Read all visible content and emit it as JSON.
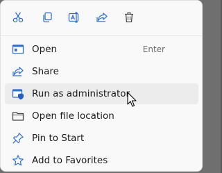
{
  "toolbar": {
    "buttons": [
      {
        "name": "cut-icon"
      },
      {
        "name": "copy-icon"
      },
      {
        "name": "rename-icon"
      },
      {
        "name": "share-icon"
      },
      {
        "name": "delete-icon"
      }
    ]
  },
  "menu": {
    "items": [
      {
        "label": "Open",
        "shortcut": "Enter",
        "icon": "app-window-icon"
      },
      {
        "label": "Share",
        "shortcut": "",
        "icon": "share-icon"
      },
      {
        "label": "Run as administrator",
        "shortcut": "",
        "icon": "admin-shield-icon"
      },
      {
        "label": "Open file location",
        "shortcut": "",
        "icon": "folder-icon"
      },
      {
        "label": "Pin to Start",
        "shortcut": "",
        "icon": "pin-icon"
      },
      {
        "label": "Add to Favorites",
        "shortcut": "",
        "icon": "star-icon"
      }
    ]
  },
  "colors": {
    "accent": "#2b6fd6",
    "menu_bg": "#f9f9f9",
    "hover_bg": "#ececec",
    "text": "#1b1b1b"
  }
}
